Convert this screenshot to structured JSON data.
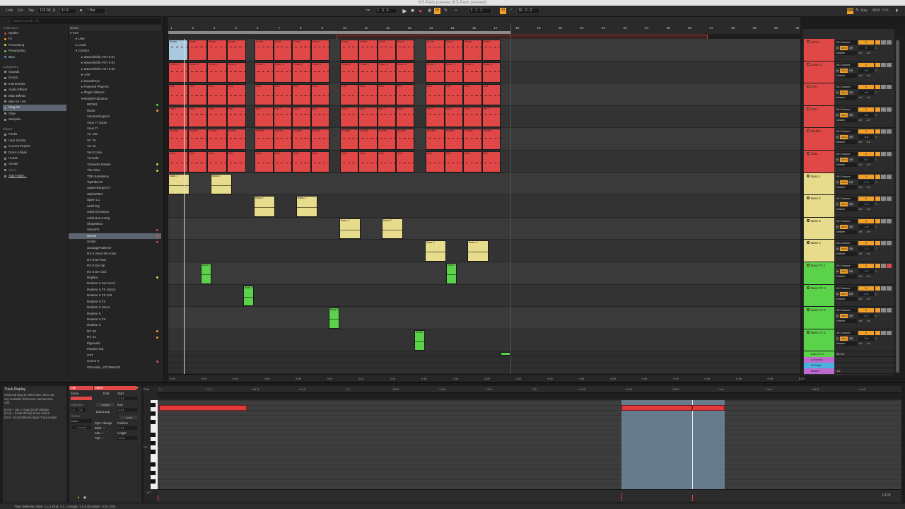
{
  "window_title": "KS Pack preview  [KS Pack preview]",
  "transport": {
    "link": "Link",
    "ext": "Ext",
    "tap": "Tap",
    "tempo": "176.00",
    "sig": "4 / 4",
    "metronome": "1 Bar",
    "position": "1 . 3 . 4",
    "loop_start": "1 . 1 . 1",
    "loop_length": "16 . 0 . 0",
    "key": "Key",
    "midi": "MIDI",
    "cpu": "0 %"
  },
  "browser": {
    "search_placeholder": "Search (Cmd + F)",
    "collections_head": "Collections",
    "collections": [
      {
        "label": "Synths",
        "color": "#e04848"
      },
      {
        "label": "Fx",
        "color": "#f2a02a"
      },
      {
        "label": "Processing",
        "color": "#e6dc3a"
      },
      {
        "label": "Resampling",
        "color": "#5ad24a"
      },
      {
        "label": "Blue",
        "color": "#4a8ae0"
      }
    ],
    "categories_head": "Categories",
    "categories": [
      "Sounds",
      "Drums",
      "Instruments",
      "Audio Effects",
      "MIDI Effects",
      "Max for Live",
      "Plug-ins",
      "Clips",
      "Samples"
    ],
    "selected_category": "Plug-ins",
    "places_head": "Places",
    "places": [
      "Packs",
      "User Library",
      "Current Project",
      "Drum n Bass",
      "House",
      "Vocals",
      "Ideas",
      "Add Folder..."
    ],
    "name_head": "Name",
    "files": [
      {
        "label": "▾ VST",
        "indent": 0,
        "dot": ""
      },
      {
        "label": "▸ User",
        "indent": 1,
        "dot": ""
      },
      {
        "label": "▸ Local",
        "indent": 1,
        "dot": ""
      },
      {
        "label": "▾ Custom",
        "indent": 1,
        "dot": ""
      },
      {
        "label": "▸ WaveShell2-VST 9.91",
        "indent": 2,
        "dot": ""
      },
      {
        "label": "▸ WaveShell3-VST 9.91",
        "indent": 2,
        "dot": ""
      },
      {
        "label": "▸ WaveShell1-VST 9.92",
        "indent": 2,
        "dot": ""
      },
      {
        "label": "▸ u-he",
        "indent": 2,
        "dot": ""
      },
      {
        "label": "▸ SoundToys",
        "indent": 2,
        "dot": ""
      },
      {
        "label": "▸ Powered Plug-ins",
        "indent": 2,
        "dot": ""
      },
      {
        "label": "▸ Plugin Alliance",
        "indent": 2,
        "dot": ""
      },
      {
        "label": "▾ MeldaProduction",
        "indent": 2,
        "dot": ""
      },
      {
        "label": "WOW2",
        "indent": 3,
        "dot": "#5ad24a"
      },
      {
        "label": "Wider",
        "indent": 3,
        "dot": "#f2a02a"
      },
      {
        "label": "VolumeShaper4",
        "indent": 3,
        "dot": ""
      },
      {
        "label": "Virus TI Snow",
        "indent": 3,
        "dot": ""
      },
      {
        "label": "Virus TI",
        "indent": 3,
        "dot": ""
      },
      {
        "label": "VC 160",
        "indent": 3,
        "dot": ""
      },
      {
        "label": "VC 76",
        "indent": 3,
        "dot": ""
      },
      {
        "label": "VC 2A",
        "indent": 3,
        "dot": ""
      },
      {
        "label": "Vari Comp",
        "indent": 3,
        "dot": ""
      },
      {
        "label": "Turnado",
        "indent": 3,
        "dot": ""
      },
      {
        "label": "Transient Master",
        "indent": 3,
        "dot": "#e6dc3a"
      },
      {
        "label": "The Glue",
        "indent": 3,
        "dot": "#e6dc3a"
      },
      {
        "label": "TDR Kotelnikov",
        "indent": 3,
        "dot": ""
      },
      {
        "label": "TapFilter-B",
        "indent": 3,
        "dot": ""
      },
      {
        "label": "SuperchargerGT",
        "indent": 3,
        "dot": ""
      },
      {
        "label": "StylusRMX",
        "indent": 3,
        "dot": ""
      },
      {
        "label": "Spire-1.1",
        "indent": 3,
        "dot": ""
      },
      {
        "label": "Solid EQ",
        "indent": 3,
        "dot": ""
      },
      {
        "label": "Solid Dynamics",
        "indent": 3,
        "dot": ""
      },
      {
        "label": "Solid Bus Comp",
        "indent": 3,
        "dot": ""
      },
      {
        "label": "ShaperBox",
        "indent": 3,
        "dot": ""
      },
      {
        "label": "ServeFX",
        "indent": 3,
        "dot": "#e04848"
      },
      {
        "label": "Serum",
        "indent": 3,
        "dot": "#e04848",
        "sel": true
      },
      {
        "label": "Scaler",
        "indent": 3,
        "dot": "#e04848"
      },
      {
        "label": "SausageFattener",
        "indent": 3,
        "dot": ""
      },
      {
        "label": "RX 6 Voice De-noise",
        "indent": 3,
        "dot": ""
      },
      {
        "label": "RX 6 De-hum",
        "indent": 3,
        "dot": ""
      },
      {
        "label": "RX 6 De-clip",
        "indent": 3,
        "dot": ""
      },
      {
        "label": "RX 6 De-click",
        "indent": 3,
        "dot": ""
      },
      {
        "label": "Replika",
        "indent": 3,
        "dot": "#e6dc3a"
      },
      {
        "label": "Reaktor 6 Surround",
        "indent": 3,
        "dot": ""
      },
      {
        "label": "Reaktor 6 FX 16x16",
        "indent": 3,
        "dot": ""
      },
      {
        "label": "Reaktor 6 FX 2x8",
        "indent": 3,
        "dot": ""
      },
      {
        "label": "Reaktor 6 FX",
        "indent": 3,
        "dot": ""
      },
      {
        "label": "Reaktor 5 16out",
        "indent": 3,
        "dot": ""
      },
      {
        "label": "Reaktor 6",
        "indent": 3,
        "dot": ""
      },
      {
        "label": "Reaktor 6 FX",
        "indent": 3,
        "dot": ""
      },
      {
        "label": "Reaktor 6",
        "indent": 3,
        "dot": ""
      },
      {
        "label": "RC 48",
        "indent": 3,
        "dot": "#f2a02a"
      },
      {
        "label": "RC 24",
        "indent": 3,
        "dot": "#f2a02a"
      },
      {
        "label": "Pigments",
        "indent": 3,
        "dot": ""
      },
      {
        "label": "Passive EQ",
        "indent": 3,
        "dot": ""
      },
      {
        "label": "OTT",
        "indent": 3,
        "dot": ""
      },
      {
        "label": "Ozone 8",
        "indent": 3,
        "dot": "#e04848"
      },
      {
        "label": "Ohmicide_VST2MachO",
        "indent": 3,
        "dot": ""
      }
    ]
  },
  "arrangement": {
    "bar_numbers": [
      "1",
      "3",
      "4",
      "5",
      "6",
      "7",
      "8",
      "9",
      "10",
      "11",
      "12",
      "13",
      "14",
      "15",
      "16",
      "17",
      "18",
      "19",
      "20",
      "21",
      "22",
      "23",
      "24",
      "25",
      "26",
      "27",
      "28",
      "29",
      "30",
      "31"
    ],
    "time_labels": [
      "0:00",
      "0:02",
      "0:04",
      "0:06",
      "0:08",
      "0:10",
      "0:12",
      "0:14",
      "0:16",
      "0:18",
      "0:20",
      "0:22",
      "0:24",
      "0:26",
      "0:28",
      "0:30",
      "0:32",
      "0:34",
      "0:36",
      "0:38",
      "0:40"
    ],
    "tracks": [
      {
        "name": "Snare",
        "color": "#e04848",
        "kind": "drum",
        "vol": "0",
        "pan": "C",
        "send": "0",
        "in": "All Channe",
        "out": "Master"
      },
      {
        "name": "Snare 2",
        "color": "#e04848",
        "kind": "drum",
        "vol": "0",
        "pan": "C",
        "send": "-inf",
        "in": "All Channe",
        "out": "Master"
      },
      {
        "name": "Kick",
        "color": "#e04848",
        "kind": "drum",
        "vol": "0",
        "pan": "C",
        "send": "-inf",
        "in": "All Channe",
        "out": "Master"
      },
      {
        "name": "Hat 1",
        "color": "#e04848",
        "kind": "drum",
        "vol": "0",
        "pan": "C",
        "send": "-inf",
        "in": "All Channe",
        "out": "Master"
      },
      {
        "name": "Shuffle",
        "color": "#e04848",
        "kind": "drum",
        "vol": "0",
        "pan": "C",
        "send": "-5.8",
        "in": "All Channe",
        "out": "Master"
      },
      {
        "name": "Ride",
        "color": "#e04848",
        "kind": "drum",
        "vol": "0",
        "pan": "C",
        "send": "0.0",
        "in": "All Channe",
        "out": "Master"
      },
      {
        "name": "Bass 1",
        "color": "#e6dc8c",
        "kind": "bass",
        "vol": "0",
        "pan": "C",
        "send": "-1.6",
        "in": "All Channe",
        "out": "Master"
      },
      {
        "name": "Bass 2",
        "color": "#e6dc8c",
        "kind": "bass",
        "vol": "0",
        "pan": "C",
        "send": "-1.6",
        "in": "All Channe",
        "out": "Master"
      },
      {
        "name": "Bass 3",
        "color": "#e6dc8c",
        "kind": "bass",
        "vol": "0",
        "pan": "C",
        "send": "-1.6",
        "in": "All Channe",
        "out": "Master"
      },
      {
        "name": "Bass 4",
        "color": "#e6dc8c",
        "kind": "bass",
        "vol": "0",
        "pan": "C",
        "send": "-1.3",
        "in": "All Channe",
        "out": "Master"
      },
      {
        "name": "Bass FX 1",
        "color": "#5ad24a",
        "kind": "fx",
        "vol": "0",
        "pan": "C",
        "send": "-7.2",
        "in": "All Channe",
        "out": "Master"
      },
      {
        "name": "Bass FX 2",
        "color": "#5ad24a",
        "kind": "fx",
        "vol": "0",
        "pan": "C",
        "send": "-2.4",
        "in": "All Channe",
        "out": "Master"
      },
      {
        "name": "Bass FX 3",
        "color": "#5ad24a",
        "kind": "fx",
        "vol": "0",
        "pan": "C",
        "send": "-8.4",
        "in": "All Channe",
        "out": "Master"
      },
      {
        "name": "Bass FX 4",
        "color": "#5ad24a",
        "kind": "fx",
        "vol": "0",
        "pan": "C",
        "send": "-3.6",
        "in": "All Channe",
        "out": "Master"
      }
    ],
    "returns": [
      {
        "name": "Bass FX 5",
        "color": "#5ad24a",
        "in": "All Ins"
      },
      {
        "name": "A Reverb",
        "color": "#c06ad0",
        "in": ""
      },
      {
        "name": "B Delay",
        "color": "#4ab0e0",
        "in": ""
      },
      {
        "name": "Master",
        "color": "#c06ad0",
        "in": "1/2"
      }
    ],
    "clip_name_drums": [
      "Snare",
      "Snare 2",
      "Kick",
      "Hat 1",
      "Shuffle",
      "Ride"
    ],
    "bass_clip_label": [
      "Bass 1",
      "Bass 2",
      "Bass 3",
      "Bass 4"
    ],
    "fx_clip_label": [
      "Bass FX",
      "Bass FX",
      "Bass FX",
      "Snare"
    ]
  },
  "track_io": {
    "input": "All Channe",
    "monitor_in": "In",
    "monitor_auto": "Auto",
    "monitor_off": "Off",
    "output": "Master",
    "send_a": "-inf",
    "send_b": "-inf"
  },
  "info_view": {
    "title": "Track Display",
    "lines": [
      "Click and drag to select time, then use",
      "any available Edit menu command to",
      "edit.",
      "[Cmd + Opt + Drag] Scroll Display",
      "[Cmd + Scroll Wheel] Zoom In/Out",
      "[Ctrl + Scroll Wheel] Adjust Track Height"
    ]
  },
  "clip_view": {
    "clip_tab": "Clip",
    "notes_tab": "Notes",
    "clip_name": "Snare",
    "fold": "Fold",
    "start": "Start",
    "end": "End",
    "loop": "Loop",
    "position": "Position",
    "length": "Length",
    "signature": "Signature",
    "sig_num": "4",
    "sig_den": "4",
    "groove": "Groove",
    "groove_val": "None",
    "legato": "Legato",
    "dupl_loop": "Dupl.Loop",
    "pgm_change": "Pgm Change",
    "bank": "Bank ---",
    "sub": "Sub ---",
    "pgm": "Pgm ---",
    "start_val": "1  1  1",
    "end_val": "1  2  1",
    "pos_val": "1  1  1",
    "len_val": "1  0  0",
    "commit": "Commit"
  },
  "note_editor": {
    "fold": "Fold",
    "ruler": [
      "1",
      "1.1.2",
      "1.1.3",
      "1.1.4",
      "1.2",
      "1.2.2",
      "1.2.3",
      "1.2.4",
      "1.3",
      "1.3.2",
      "1.3.3",
      "1.3.4",
      "1.4",
      "1.4.2",
      "1.4.3",
      "1.4.4"
    ],
    "key_label": "C3",
    "vel_label": "127",
    "page_label": "1/128"
  },
  "status": {
    "text": "Time Selection   Start: 1.1.1   End: 2.1.1   Length: 1.0.0  (Duration: 0:01.371)"
  }
}
